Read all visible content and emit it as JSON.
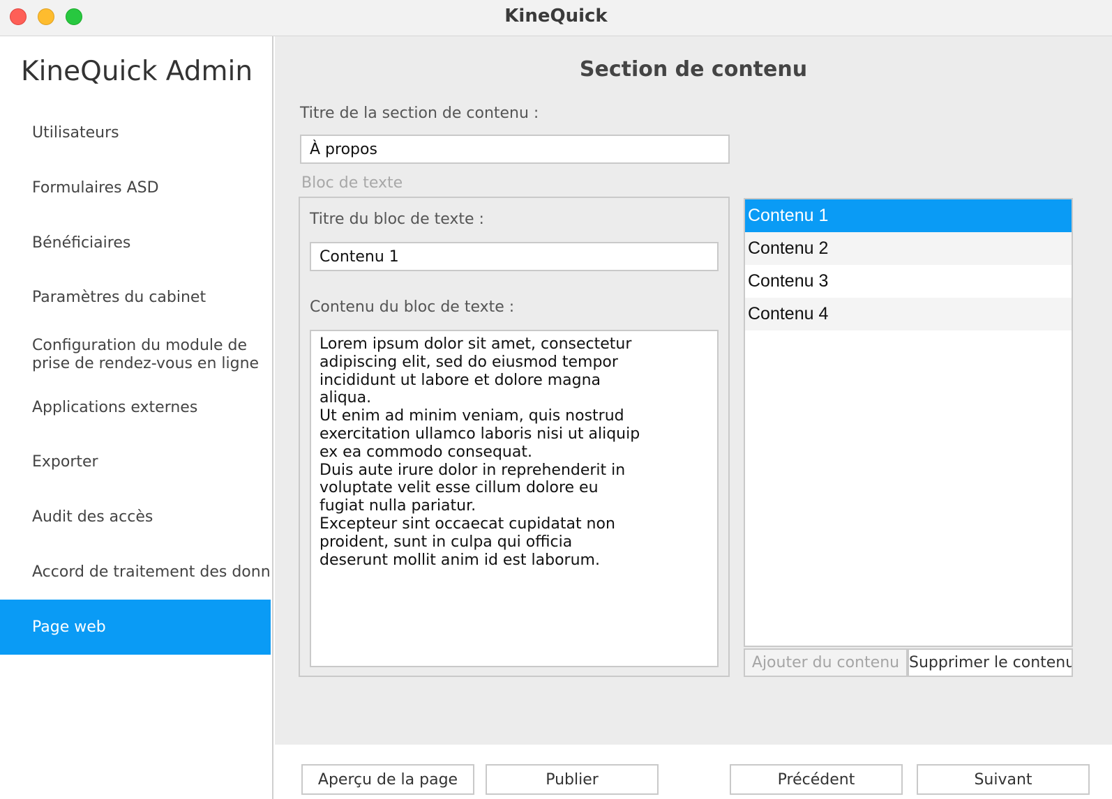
{
  "window": {
    "title": "KineQuick"
  },
  "sidebar": {
    "title": "KineQuick Admin",
    "items": [
      {
        "label": "Utilisateurs"
      },
      {
        "label": "Formulaires ASD"
      },
      {
        "label": "Bénéficiaires"
      },
      {
        "label": "Paramètres du cabinet"
      },
      {
        "label": "Configuration du module de\nprise de rendez-vous en ligne"
      },
      {
        "label": "Applications externes"
      },
      {
        "label": "Exporter"
      },
      {
        "label": "Audit des accès"
      },
      {
        "label": "Accord de traitement des donn"
      },
      {
        "label": "Page web",
        "active": true
      }
    ]
  },
  "main": {
    "heading": "Section de contenu",
    "section_title_label": "Titre de la section de contenu :",
    "section_title_value": "À propos",
    "text_block_group_label": "Bloc de texte",
    "text_block_title_label": "Titre du bloc de texte :",
    "text_block_title_value": "Contenu 1",
    "text_block_content_label": "Contenu du bloc de texte :",
    "text_block_content_value": "Lorem ipsum dolor sit amet, consectetur\nadipiscing elit, sed do eiusmod tempor\nincididunt ut labore et dolore magna\naliqua.\nUt enim ad minim veniam, quis nostrud\nexercitation ullamco laboris nisi ut aliquip\nex ea commodo consequat.\nDuis aute irure dolor in reprehenderit in\nvoluptate velit esse cillum dolore eu\nfugiat nulla pariatur.\nExcepteur sint occaecat cupidatat non\nproident, sunt in culpa qui officia\ndeserunt mollit anim id est laborum.",
    "content_list": [
      {
        "label": "Contenu 1",
        "selected": true
      },
      {
        "label": "Contenu 2"
      },
      {
        "label": "Contenu 3"
      },
      {
        "label": "Contenu 4"
      }
    ],
    "add_content_label": "Ajouter du contenu",
    "remove_content_label": "Supprimer le contenu"
  },
  "footer": {
    "preview_label": "Aperçu de la page",
    "publish_label": "Publier",
    "previous_label": "Précédent",
    "next_label": "Suivant"
  },
  "colors": {
    "accent": "#0a9bf5",
    "panel_bg": "#ececec",
    "border": "#c9c9c9"
  }
}
